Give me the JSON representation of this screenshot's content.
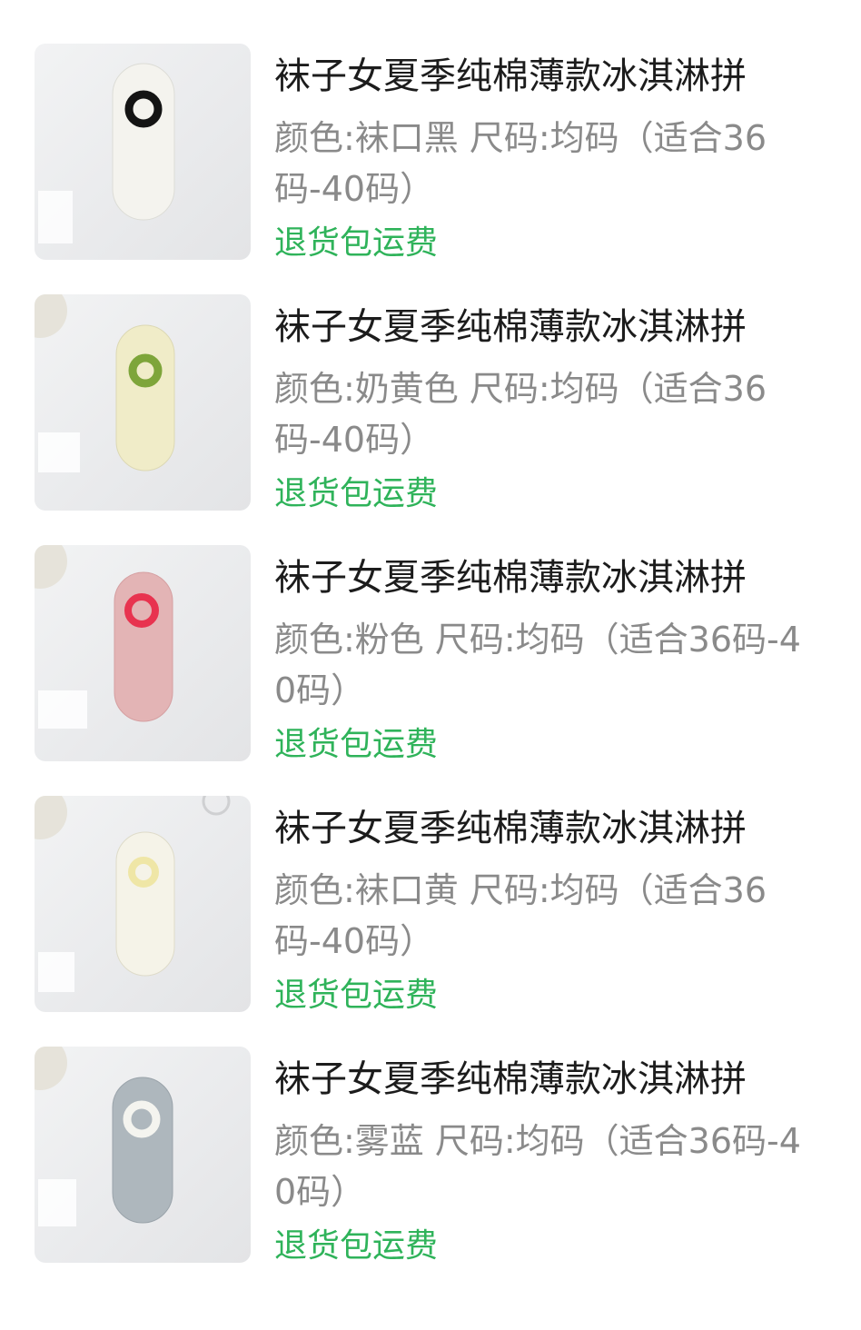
{
  "items": [
    {
      "title": "袜子女夏季纯棉薄款冰淇淋拼",
      "spec": "颜色:袜口黑 尺码:均码（适合36码-40码）",
      "tag": "退货包运费",
      "sock_color": "#f4f3ee",
      "ring_color": "#141414"
    },
    {
      "title": "袜子女夏季纯棉薄款冰淇淋拼",
      "spec": "颜色:奶黄色 尺码:均码（适合36码-40码）",
      "tag": "退货包运费",
      "sock_color": "#f0ecc8",
      "ring_color": "#7ea53a"
    },
    {
      "title": "袜子女夏季纯棉薄款冰淇淋拼",
      "spec": "颜色:粉色 尺码:均码（适合36码-40码）",
      "tag": "退货包运费",
      "sock_color": "#e3b4b5",
      "ring_color": "#e8334f"
    },
    {
      "title": "袜子女夏季纯棉薄款冰淇淋拼",
      "spec": "颜色:袜口黄 尺码:均码（适合36码-40码）",
      "tag": "退货包运费",
      "sock_color": "#f5f3e8",
      "ring_color": "#efe6a6"
    },
    {
      "title": "袜子女夏季纯棉薄款冰淇淋拼",
      "spec": "颜色:雾蓝 尺码:均码（适合36码-40码）",
      "tag": "退货包运费",
      "sock_color": "#aeb7bd",
      "ring_color": "#f4f4ef"
    }
  ]
}
